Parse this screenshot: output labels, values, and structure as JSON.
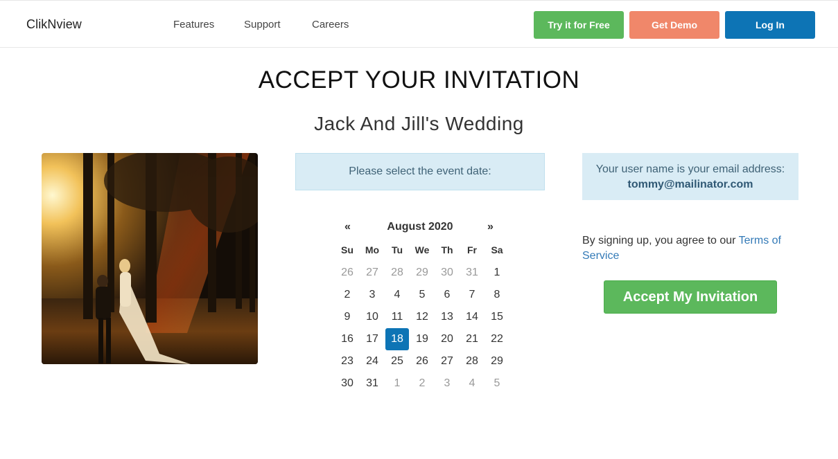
{
  "header": {
    "brand": "ClikNview",
    "nav": [
      "Features",
      "Support",
      "Careers"
    ],
    "try_label": "Try it for Free",
    "demo_label": "Get Demo",
    "login_label": "Log In"
  },
  "main": {
    "title": "ACCEPT YOUR INVITATION",
    "event_name": "Jack And Jill's Wedding",
    "date_prompt": "Please select the event date:",
    "calendar": {
      "prev": "«",
      "next": "»",
      "month_label": "August 2020",
      "weekdays": [
        "Su",
        "Mo",
        "Tu",
        "We",
        "Th",
        "Fr",
        "Sa"
      ],
      "weeks": [
        [
          "26",
          "27",
          "28",
          "29",
          "30",
          "31",
          "1"
        ],
        [
          "2",
          "3",
          "4",
          "5",
          "6",
          "7",
          "8"
        ],
        [
          "9",
          "10",
          "11",
          "12",
          "13",
          "14",
          "15"
        ],
        [
          "16",
          "17",
          "18",
          "19",
          "20",
          "21",
          "22"
        ],
        [
          "23",
          "24",
          "25",
          "26",
          "27",
          "28",
          "29"
        ],
        [
          "30",
          "31",
          "1",
          "2",
          "3",
          "4",
          "5"
        ]
      ],
      "selected_day": "18"
    },
    "username_note": "Your user name is your email address:",
    "email": "tommy@mailinator.com",
    "terms_prefix": "By signing up, you agree to our ",
    "terms_link": "Terms of Service",
    "accept_label": "Accept My Invitation"
  },
  "colors": {
    "green": "#5cb85c",
    "salmon": "#f0876a",
    "blue": "#0d74b5",
    "info_bg": "#d9ecf5"
  }
}
